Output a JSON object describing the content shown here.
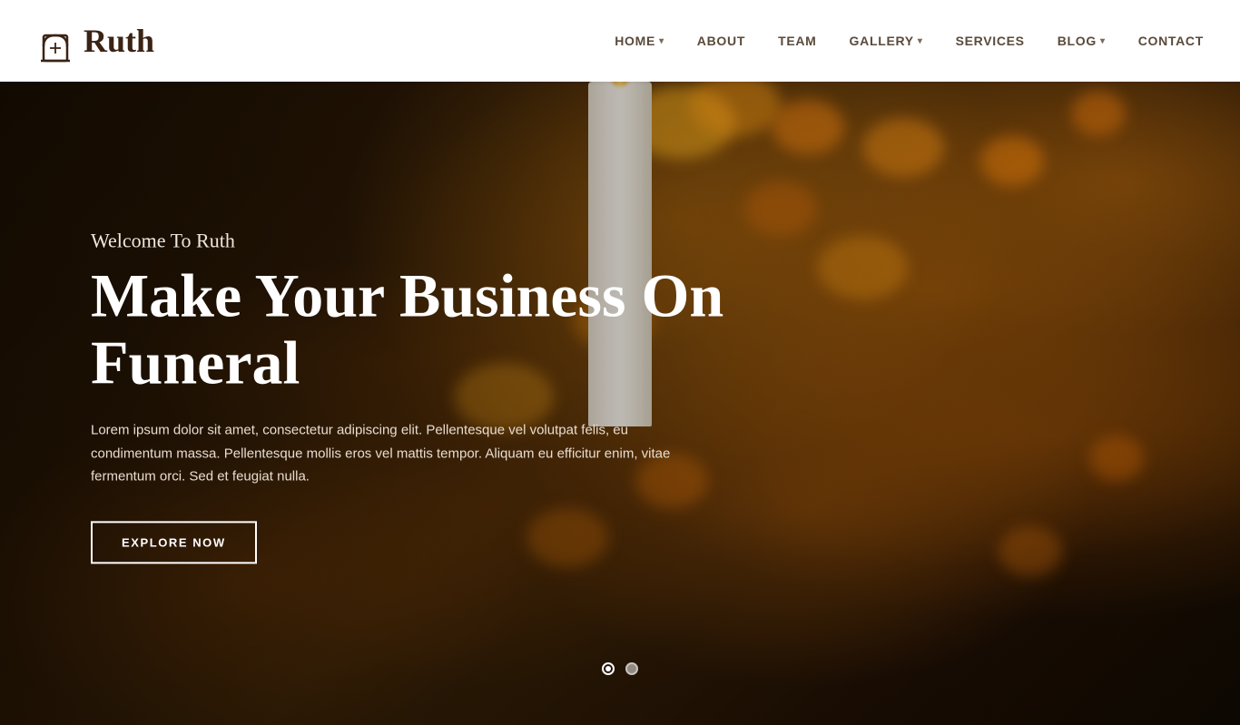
{
  "header": {
    "logo_text": "Ruth",
    "logo_icon_aria": "tombstone-icon",
    "nav": [
      {
        "label": "HOME",
        "has_dropdown": true,
        "id": "home"
      },
      {
        "label": "ABOUT",
        "has_dropdown": false,
        "id": "about"
      },
      {
        "label": "TEAM",
        "has_dropdown": false,
        "id": "team"
      },
      {
        "label": "GALLERY",
        "has_dropdown": true,
        "id": "gallery"
      },
      {
        "label": "SERVICES",
        "has_dropdown": false,
        "id": "services"
      },
      {
        "label": "BLOG",
        "has_dropdown": true,
        "id": "blog"
      },
      {
        "label": "CONTACT",
        "has_dropdown": false,
        "id": "contact"
      }
    ]
  },
  "hero": {
    "subtitle": "Welcome To Ruth",
    "title": "Make Your Business On Funeral",
    "description": "Lorem ipsum dolor sit amet, consectetur adipiscing elit. Pellentesque vel volutpat felis, eu condimentum massa. Pellentesque mollis eros vel mattis tempor. Aliquam eu efficitur enim, vitae fermentum orci. Sed et feugiat nulla.",
    "cta_label": "EXPLORE NOW",
    "slide_count": 2,
    "active_slide": 0
  },
  "colors": {
    "brand_brown": "#3b2314",
    "nav_text": "#5a4a3a",
    "hero_overlay": "rgba(10,5,0,0.55)"
  }
}
